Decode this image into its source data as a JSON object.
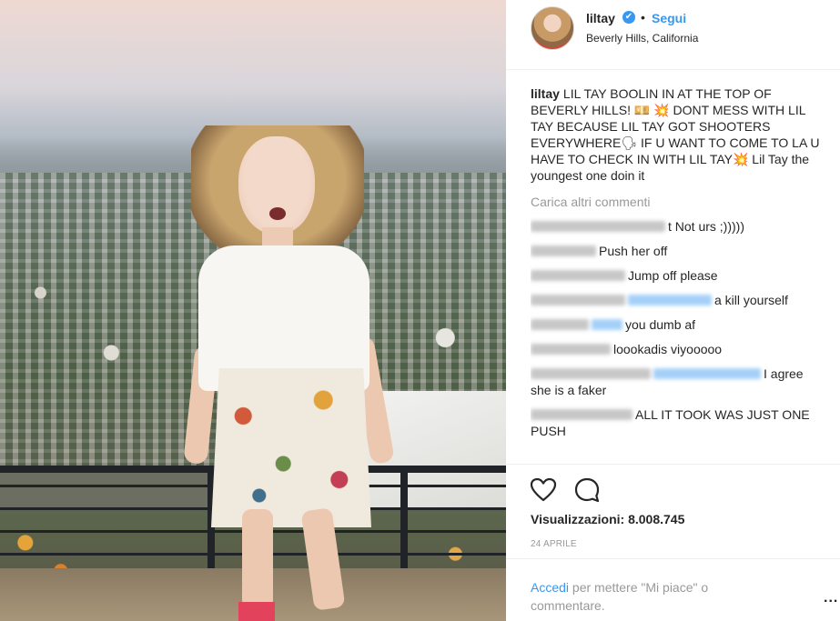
{
  "post": {
    "username": "liltay",
    "verified_glyph": "✔",
    "separator": "•",
    "follow_label": "Segui",
    "location": "Beverly Hills, California"
  },
  "caption": {
    "user": "liltay",
    "text": "LIL TAY BOOLIN IN AT THE TOP OF BEVERLY HILLS! 💴 💥  DONT MESS WITH LIL TAY BECAUSE LIL TAY GOT SHOOTERS EVERYWHERE🗣 IF U WANT TO COME TO LA U HAVE TO CHECK IN WITH LIL TAY💥 Lil Tay the youngest one doin it"
  },
  "load_more": "Carica altri commenti",
  "comments": [
    {
      "text": "t Not urs ;)))))"
    },
    {
      "text": "Push her off"
    },
    {
      "text": "Jump off please"
    },
    {
      "text": "a kill yourself"
    },
    {
      "text": "you dumb af"
    },
    {
      "text": "loookadis viyooooo"
    },
    {
      "text": "I agree she is a faker"
    },
    {
      "text": "ALL IT TOOK WAS JUST ONE PUSH"
    }
  ],
  "actions": {
    "views": "Visualizzazioni: 8.008.745",
    "date": "24 APRILE",
    "login_link": "Accedi",
    "login_rest": " per mettere \"Mi piace\" o commentare.",
    "more": "..."
  },
  "icons": {
    "like": "heart-outline-icon",
    "comment": "comment-bubble-icon",
    "verified": "verified-badge-icon"
  },
  "colors": {
    "link": "#3897f0",
    "muted": "#999999",
    "text": "#262626",
    "divider": "#efefef"
  }
}
